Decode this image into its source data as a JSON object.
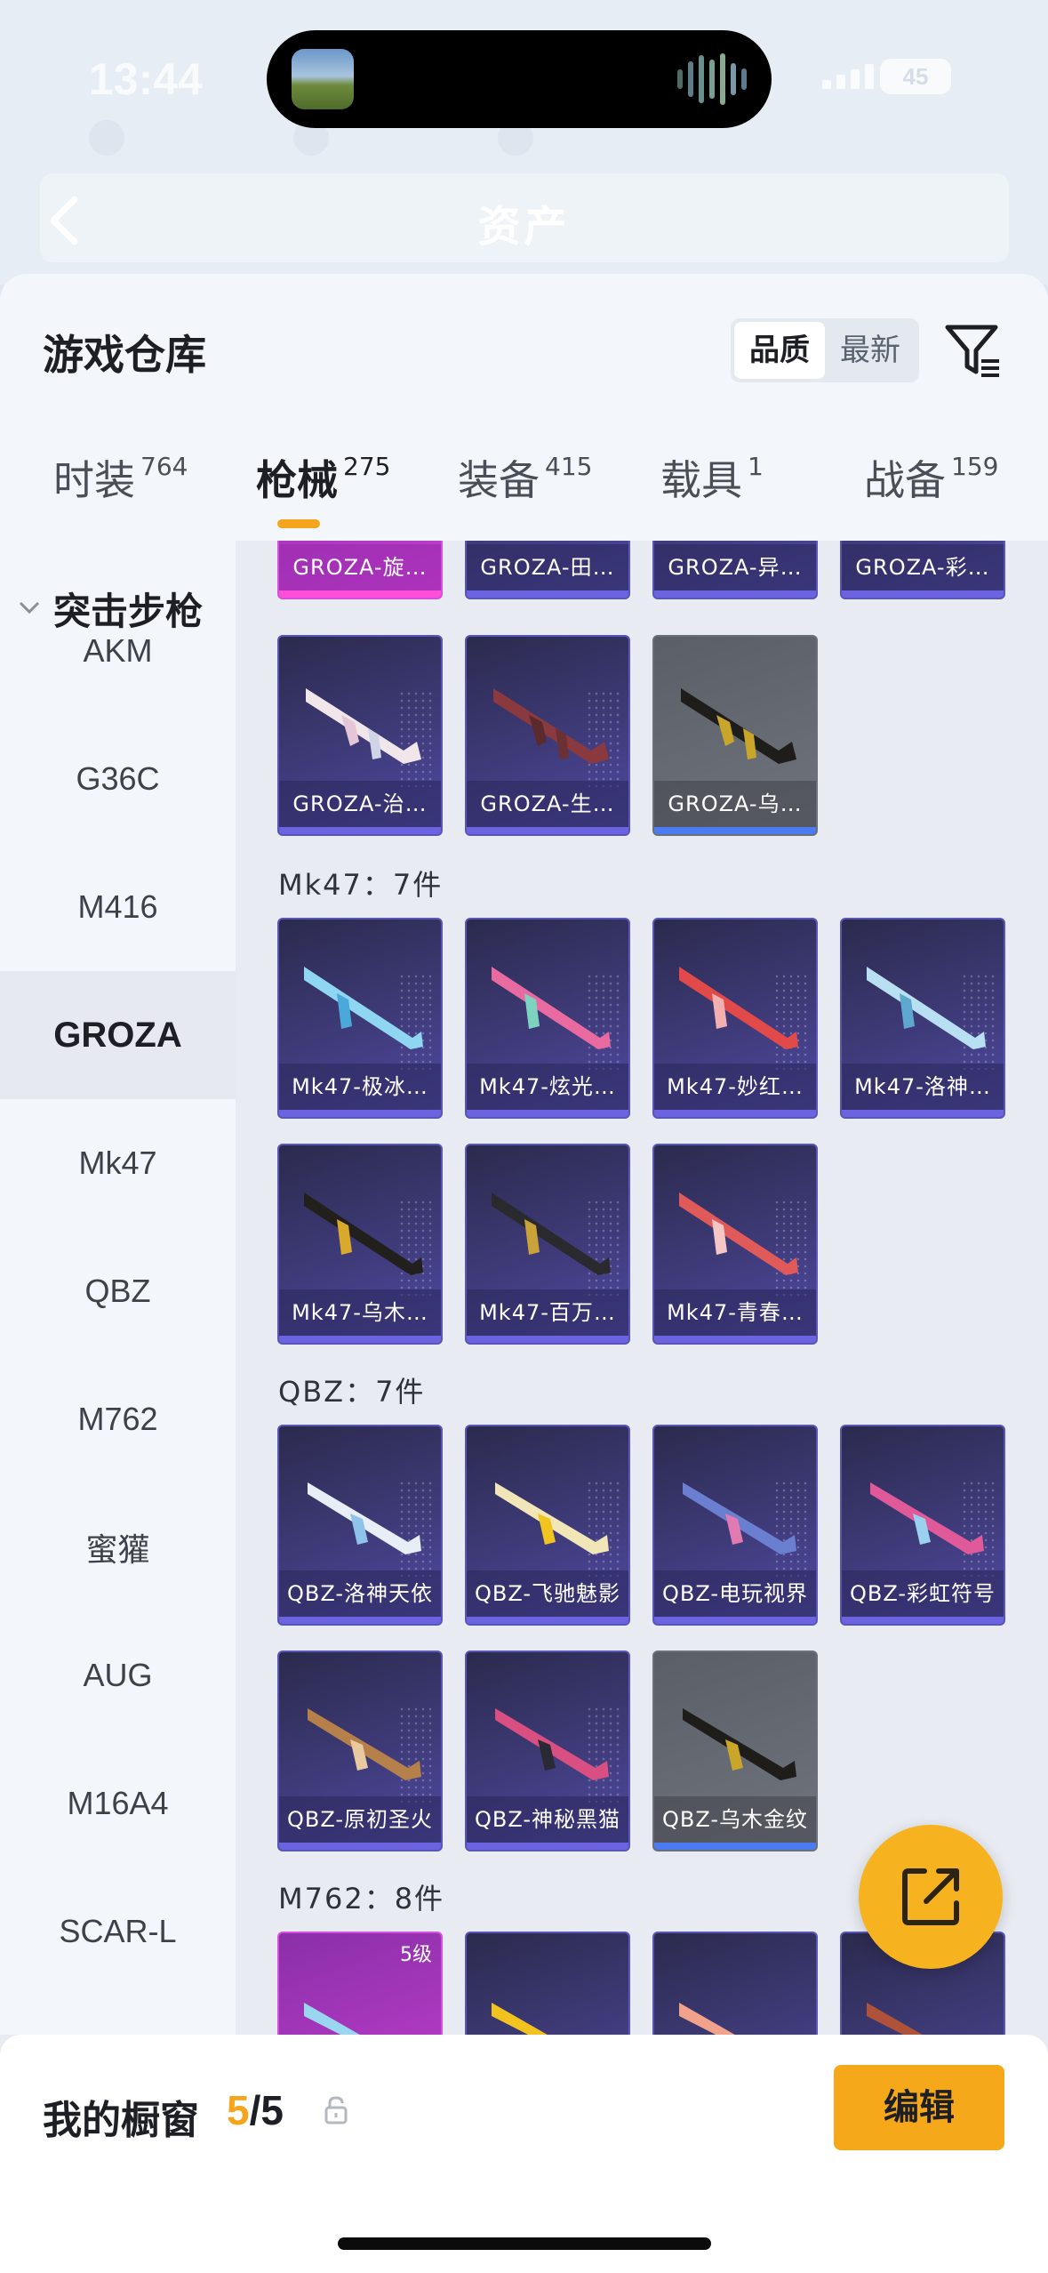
{
  "status": {
    "time": "13:44",
    "battery": "45"
  },
  "nav": {
    "title": "资产"
  },
  "sheet": {
    "title": "游戏仓库",
    "sort": [
      "品质",
      "最新"
    ],
    "tabs": [
      {
        "label": "时装",
        "count": "764"
      },
      {
        "label": "枪械",
        "count": "275"
      },
      {
        "label": "装备",
        "count": "415"
      },
      {
        "label": "载具",
        "count": "1"
      },
      {
        "label": "战备",
        "count": "159"
      }
    ]
  },
  "sidebar": {
    "category": "突击步枪",
    "items": [
      "AKM",
      "G36C",
      "M416",
      "GROZA",
      "Mk47",
      "QBZ",
      "M762",
      "蜜獾",
      "AUG",
      "M16A4",
      "SCAR-L"
    ]
  },
  "content": {
    "groza_top": [
      "GROZA-旋…",
      "GROZA-田…",
      "GROZA-异…",
      "GROZA-彩…"
    ],
    "groza_row2": [
      "GROZA-治…",
      "GROZA-生…",
      "GROZA-乌…"
    ],
    "mk47_label": "Mk47：7件",
    "mk47": [
      "Mk47-极冰…",
      "Mk47-炫光…",
      "Mk47-妙红…",
      "Mk47-洛神…",
      "Mk47-乌木…",
      "Mk47-百万…",
      "Mk47-青春…"
    ],
    "qbz_label": "QBZ：7件",
    "qbz": [
      "QBZ-洛神天依",
      "QBZ-飞驰魅影",
      "QBZ-电玩视界",
      "QBZ-彩虹符号",
      "QBZ-原初圣火",
      "QBZ-神秘黑猫",
      "QBZ-乌木金纹"
    ],
    "m762_label": "M762：8件",
    "m762_level": "5级"
  },
  "bottom": {
    "label": "我的橱窗",
    "current": "5",
    "total": "/5",
    "edit": "编辑"
  },
  "colors": {
    "accent": "#f5a51b",
    "card": "#3f3b7a"
  }
}
